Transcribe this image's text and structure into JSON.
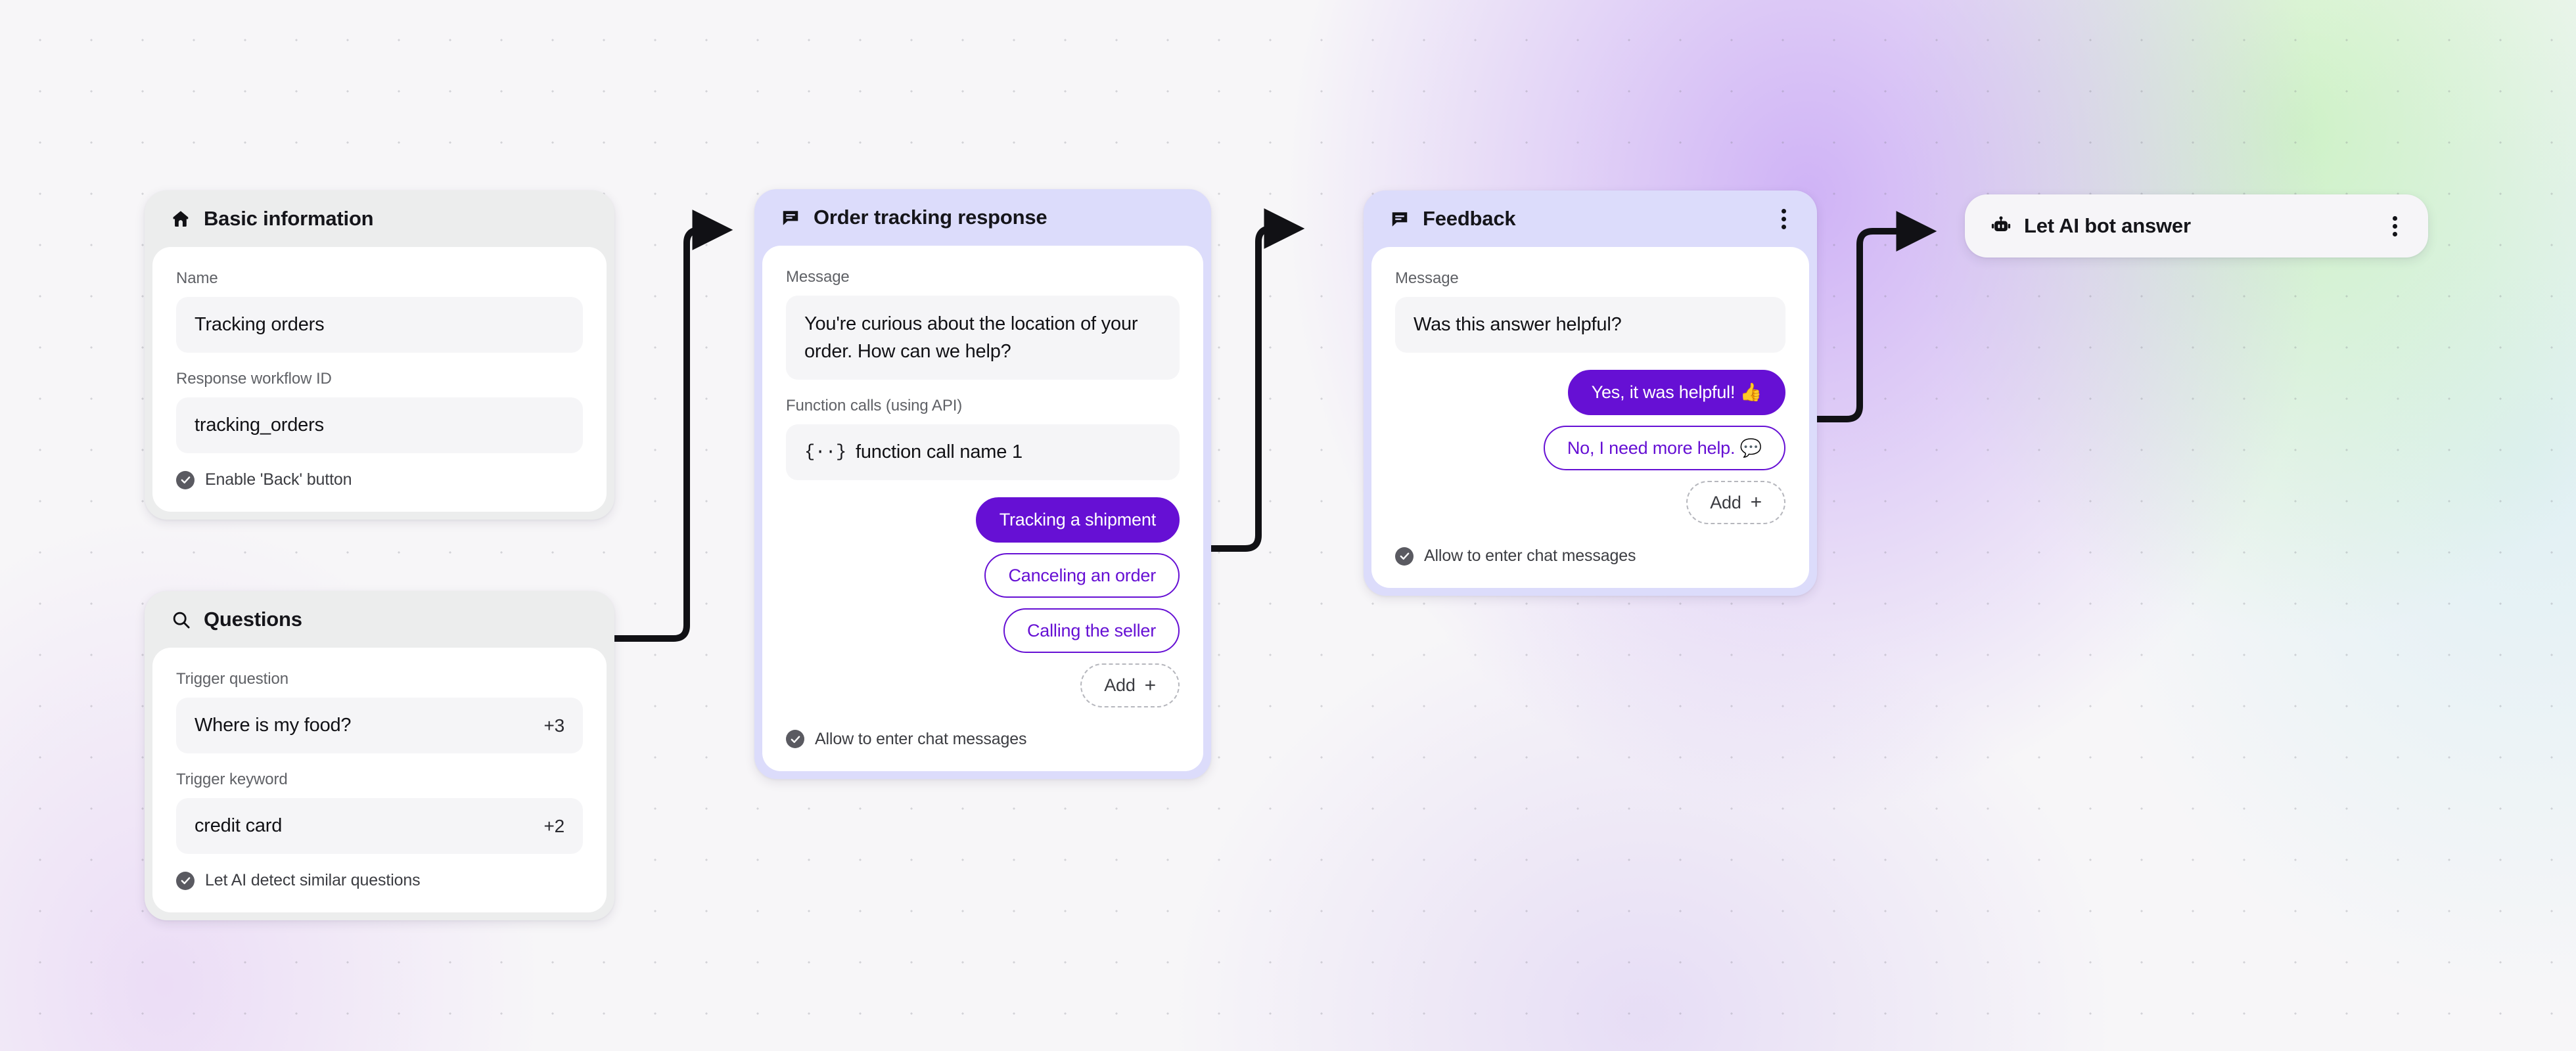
{
  "canvas": {
    "background_left": "#f7f6f8",
    "accent_purple": "#6610d4",
    "card_lilac": "#dcdcfb",
    "card_gray": "#eceded"
  },
  "cards": {
    "basic_information": {
      "icon": "home-icon",
      "title": "Basic information",
      "fields": [
        {
          "label": "Name",
          "value": "Tracking orders"
        },
        {
          "label": "Response workflow ID",
          "value": "tracking_orders"
        }
      ],
      "checkbox": {
        "label": "Enable 'Back' button",
        "checked": true
      }
    },
    "questions": {
      "icon": "search-icon",
      "title": "Questions",
      "fields": [
        {
          "label": "Trigger question",
          "value": "Where is my food?",
          "more": "+3"
        },
        {
          "label": "Trigger keyword",
          "value": "credit card",
          "more": "+2"
        }
      ],
      "checkbox": {
        "label": "Let AI detect similar questions",
        "checked": true
      }
    },
    "order_tracking_response": {
      "icon": "message-icon",
      "title": "Order tracking response",
      "message_label": "Message",
      "message_value": "You're curious about the location of your order. How can we help?",
      "function_label": "Function calls (using API)",
      "function_value": "function call name 1",
      "function_brace": "{··}",
      "chips": [
        {
          "label": "Tracking a shipment",
          "style": "solid"
        },
        {
          "label": "Canceling an order",
          "style": "outline"
        },
        {
          "label": "Calling the seller",
          "style": "outline"
        }
      ],
      "add_label": "Add",
      "add_plus": "+",
      "checkbox": {
        "label": "Allow to enter chat messages",
        "checked": true
      }
    },
    "feedback": {
      "icon": "message-icon",
      "title": "Feedback",
      "menu_icon": "kebab-menu-icon",
      "message_label": "Message",
      "message_value": "Was this answer helpful?",
      "chips": [
        {
          "label": "Yes, it was helpful! 👍",
          "style": "solid"
        },
        {
          "label": "No, I need more help. 💬",
          "style": "outline"
        }
      ],
      "add_label": "Add",
      "add_plus": "+",
      "checkbox": {
        "label": "Allow to enter chat messages",
        "checked": true
      }
    },
    "let_ai_bot_answer": {
      "icon": "robot-icon",
      "title": "Let AI bot answer",
      "menu_icon": "kebab-menu-icon"
    }
  },
  "connectors": [
    {
      "from": "questions",
      "to": "order_tracking_response"
    },
    {
      "from": "order_tracking_response_chip_tracking_a_shipment",
      "to": "feedback"
    },
    {
      "from": "feedback_chip_yes_it_was_helpful",
      "to": "let_ai_bot_answer"
    }
  ]
}
